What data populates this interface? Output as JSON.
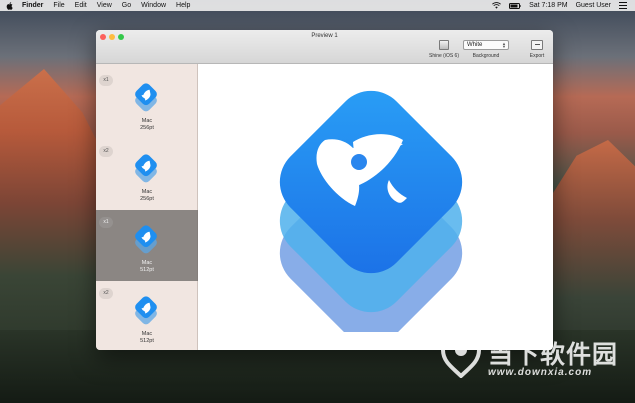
{
  "menubar": {
    "app": "Finder",
    "items": [
      "File",
      "Edit",
      "View",
      "Go",
      "Window",
      "Help"
    ],
    "clock": "Sat 7:18 PM",
    "user": "Guest User"
  },
  "window": {
    "title": "Preview 1",
    "toolbar": {
      "shine_label": "Shine (iOS 6)",
      "background_value": "White",
      "background_label": "Background",
      "export_label": "Export"
    }
  },
  "sidebar": {
    "thumbnails": [
      {
        "scale": "x1",
        "name": "Mac",
        "size": "256pt",
        "selected": false
      },
      {
        "scale": "x2",
        "name": "Mac",
        "size": "256pt",
        "selected": false
      },
      {
        "scale": "x1",
        "name": "Mac",
        "size": "512pt",
        "selected": true
      },
      {
        "scale": "x2",
        "name": "Mac",
        "size": "512pt",
        "selected": false
      }
    ]
  },
  "watermark": {
    "text": "当下软件园",
    "url": "www.downxia.com"
  },
  "colors": {
    "icon_top": "#1f8ff0",
    "icon_mid": "#4fb0ec",
    "icon_bottom": "#6a98e2",
    "menubar": "#ececec"
  }
}
